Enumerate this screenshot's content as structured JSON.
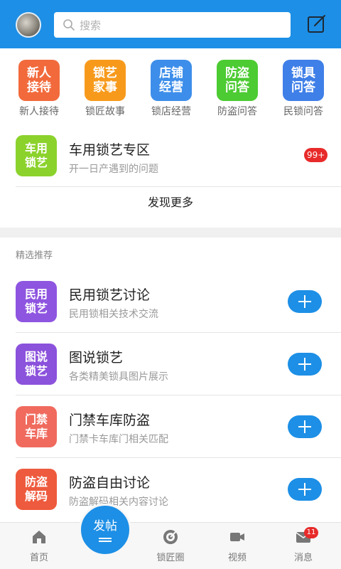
{
  "header": {
    "search_placeholder": "搜索",
    "avatar_icon": "user-avatar",
    "edit_icon": "compose-icon",
    "background": "#1d8fe6"
  },
  "quick_links": [
    {
      "tile_text": "新人\n接待",
      "label": "新人接待",
      "color": "#f26a3c"
    },
    {
      "tile_text": "锁艺\n家事",
      "label": "锁匠故事",
      "color": "#f79a1c"
    },
    {
      "tile_text": "店铺\n经营",
      "label": "锁店经营",
      "color": "#3d8eea"
    },
    {
      "tile_text": "防盗\n问答",
      "label": "防盗问答",
      "color": "#4ccb33"
    },
    {
      "tile_text": "锁具\n问答",
      "label": "民锁问答",
      "color": "#3f7fe8"
    }
  ],
  "featured": {
    "tile_text": "车用\n锁艺",
    "tile_color": "#8bd22c",
    "title": "车用锁艺专区",
    "subtitle": "开一日产遇到的问题",
    "badge": "99+",
    "more_label": "发现更多"
  },
  "recommend": {
    "heading": "精选推荐",
    "items": [
      {
        "tile_text": "民用\n锁艺",
        "title": "民用锁艺讨论",
        "subtitle": "民用锁相关技术交流",
        "color": "#8e55e0"
      },
      {
        "tile_text": "图说\n锁艺",
        "title": "图说锁艺",
        "subtitle": "各类精美锁具图片展示",
        "color": "#8b52dc"
      },
      {
        "tile_text": "门禁\n车库",
        "title": "门禁车库防盗",
        "subtitle": "门禁卡车库门相关匹配",
        "color": "#f06a5e"
      },
      {
        "tile_text": "防盗\n解码",
        "title": "防盗自由讨论",
        "subtitle": "防盗解码相关内容讨论",
        "color": "#ee5a3d"
      }
    ]
  },
  "bottom_nav": {
    "home": "首页",
    "post": "发帖",
    "circle": "锁匠圈",
    "video": "视频",
    "messages": "消息",
    "message_badge": "11"
  }
}
